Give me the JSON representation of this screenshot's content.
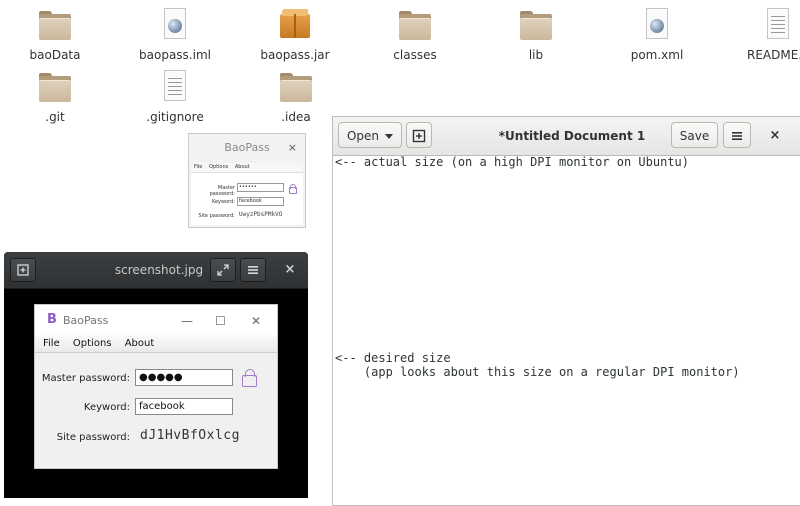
{
  "desktop": {
    "files": [
      {
        "name": "baoData",
        "icon": "folder-icon"
      },
      {
        "name": "baopass.iml",
        "icon": "xml-document-icon"
      },
      {
        "name": "baopass.jar",
        "icon": "jar-archive-icon"
      },
      {
        "name": "classes",
        "icon": "folder-icon"
      },
      {
        "name": "lib",
        "icon": "folder-icon"
      },
      {
        "name": "pom.xml",
        "icon": "xml-document-icon"
      },
      {
        "name": "README.m",
        "icon": "text-document-icon"
      },
      {
        "name": ".git",
        "icon": "folder-icon"
      },
      {
        "name": ".gitignore",
        "icon": "text-document-icon"
      },
      {
        "name": ".idea",
        "icon": "folder-icon"
      }
    ]
  },
  "editor": {
    "open_label": "Open",
    "title": "*Untitled Document 1",
    "save_label": "Save",
    "close_glyph": "×",
    "lines": {
      "l1": "<-- actual size (on a high DPI monitor on Ubuntu)",
      "l2": "<-- desired size",
      "l3": "    (app looks about this size on a regular DPI monitor)"
    }
  },
  "baopass_small": {
    "title": "BaoPass",
    "close_glyph": "×",
    "menu": {
      "file": "File",
      "options": "Options",
      "about": "About"
    },
    "master_label": "Master password:",
    "master_value": "••••••",
    "keyword_label": "Keyword:",
    "keyword_value": "facebook",
    "site_label": "Site password:",
    "site_value": "UwyzPbsPMkVO"
  },
  "viewer": {
    "title": "screenshot.jpg",
    "close_glyph": "×"
  },
  "baopass_big": {
    "logo": "B",
    "title": "BaoPass",
    "minimize_glyph": "—",
    "maximize_glyph": "☐",
    "close_glyph": "✕",
    "menu": {
      "file": "File",
      "options": "Options",
      "about": "About"
    },
    "master_label": "Master password:",
    "master_value": "●●●●●",
    "keyword_label": "Keyword:",
    "keyword_value": "facebook",
    "site_label": "Site password:",
    "site_value": "dJ1HvBfOxlcg"
  },
  "colors": {
    "accent_purple": "#a07cc9",
    "folder_tan": "#cbb89d",
    "viewer_header": "#3c3f41"
  }
}
